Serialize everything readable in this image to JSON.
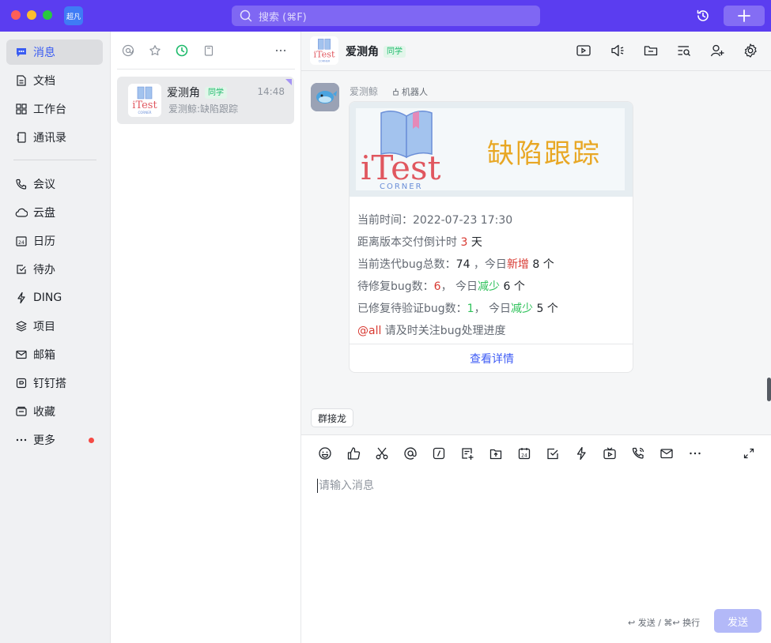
{
  "titlebar": {
    "user_badge": "超凡",
    "search_placeholder": "搜索 (⌘F)"
  },
  "nav": {
    "items": [
      {
        "label": "消息",
        "icon": "message-icon"
      },
      {
        "label": "文档",
        "icon": "document-icon"
      },
      {
        "label": "工作台",
        "icon": "workbench-icon"
      },
      {
        "label": "通讯录",
        "icon": "contacts-icon"
      },
      {
        "label": "会议",
        "icon": "meeting-icon"
      },
      {
        "label": "云盘",
        "icon": "cloud-icon"
      },
      {
        "label": "日历",
        "icon": "calendar-icon"
      },
      {
        "label": "待办",
        "icon": "todo-icon"
      },
      {
        "label": "DING",
        "icon": "lightning-icon"
      },
      {
        "label": "项目",
        "icon": "project-icon"
      },
      {
        "label": "邮箱",
        "icon": "mail-icon"
      },
      {
        "label": "钉钉搭",
        "icon": "builder-icon"
      },
      {
        "label": "收藏",
        "icon": "favorite-icon"
      },
      {
        "label": "更多",
        "icon": "more-icon"
      }
    ]
  },
  "conversation": {
    "name": "爱测角",
    "tag": "同学",
    "time": "14:48",
    "preview": "爱测鲸:缺陷跟踪"
  },
  "chat": {
    "title": "爱测角",
    "tag": "同学",
    "sender": "爱测鲸",
    "bot_label": "机器人",
    "banner": {
      "logo_text": "iTest",
      "logo_sub": "CORNER",
      "title": "缺陷跟踪"
    },
    "card": {
      "time_label": "当前时间：",
      "time_value": "2022-07-23 17:30",
      "countdown_prefix": "距离版本交付倒计时 ",
      "countdown_value": "3",
      "countdown_suffix": " 天",
      "total_prefix": "当前迭代bug总数：",
      "total_value": "74",
      "total_mid": " ，今日",
      "total_new": "新增",
      "total_new_value": " 8 个",
      "pending_prefix": "待修复bug数：",
      "pending_value": "6",
      "pending_mid": "， 今日",
      "pending_dec": "减少",
      "pending_dec_value": " 6 个",
      "verify_prefix": "已修复待验证bug数：",
      "verify_value": "1",
      "verify_mid": "， 今日",
      "verify_dec": "减少",
      "verify_dec_value": " 5 个",
      "at_all": "@all",
      "notice": " 请及时关注bug处理进度",
      "link": "查看详情"
    },
    "chip": "群接龙",
    "input_placeholder": "请输入消息",
    "hint": "↩ 发送 / ⌘↩ 换行",
    "send": "发送"
  },
  "colors": {
    "accent": "#5b3df0",
    "link": "#3f5cf5",
    "red": "#d83931",
    "green": "#2ec25a",
    "banner_title": "#e8a724"
  }
}
